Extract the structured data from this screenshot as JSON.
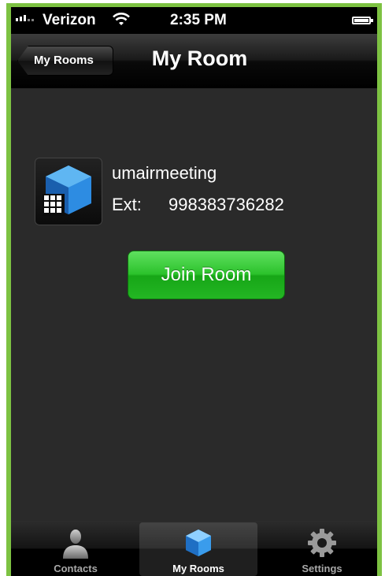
{
  "status_bar": {
    "carrier": "Verizon",
    "time": "2:35 PM"
  },
  "nav_bar": {
    "back_label": "My Rooms",
    "title": "My Room"
  },
  "room": {
    "name": "umairmeeting",
    "ext_label": "Ext:",
    "ext_value": "998383736282",
    "icon": "room-cube-icon"
  },
  "join_button_label": "Join Room",
  "tab_bar": {
    "tabs": [
      {
        "label": "Contacts",
        "icon": "person-icon",
        "active": false
      },
      {
        "label": "My Rooms",
        "icon": "cube-icon",
        "active": true
      },
      {
        "label": "Settings",
        "icon": "gear-icon",
        "active": false
      }
    ]
  },
  "colors": {
    "accent_green": "#2cc22c",
    "frame_green": "#7dc242",
    "cube_blue": "#2e8fe0"
  }
}
